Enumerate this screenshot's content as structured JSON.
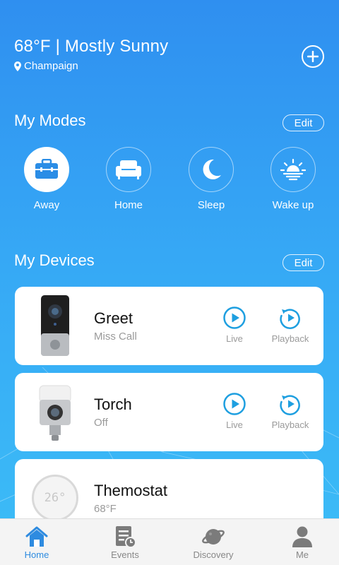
{
  "header": {
    "weather": "68°F | Mostly Sunny",
    "location": "Champaign"
  },
  "modes": {
    "title": "My Modes",
    "edit_label": "Edit",
    "items": [
      {
        "label": "Away",
        "icon": "briefcase-icon",
        "active": true
      },
      {
        "label": "Home",
        "icon": "sofa-icon",
        "active": false
      },
      {
        "label": "Sleep",
        "icon": "moon-icon",
        "active": false
      },
      {
        "label": "Wake up",
        "icon": "sunrise-icon",
        "active": false
      }
    ]
  },
  "devices": {
    "title": "My Devices",
    "edit_label": "Edit",
    "items": [
      {
        "name": "Greet",
        "status": "Miss Call",
        "live_label": "Live",
        "playback_label": "Playback"
      },
      {
        "name": "Torch",
        "status": "Off",
        "live_label": "Live",
        "playback_label": "Playback"
      },
      {
        "name": "Themostat",
        "status": "68°F",
        "display": "26°"
      }
    ]
  },
  "tabbar": {
    "items": [
      {
        "label": "Home",
        "icon": "home-icon",
        "active": true
      },
      {
        "label": "Events",
        "icon": "events-icon",
        "active": false
      },
      {
        "label": "Discovery",
        "icon": "planet-icon",
        "active": false
      },
      {
        "label": "Me",
        "icon": "person-icon",
        "active": false
      }
    ]
  },
  "colors": {
    "accent": "#2e8be0",
    "background_top": "#2f8ff0",
    "background_bottom": "#3cbdf7"
  }
}
